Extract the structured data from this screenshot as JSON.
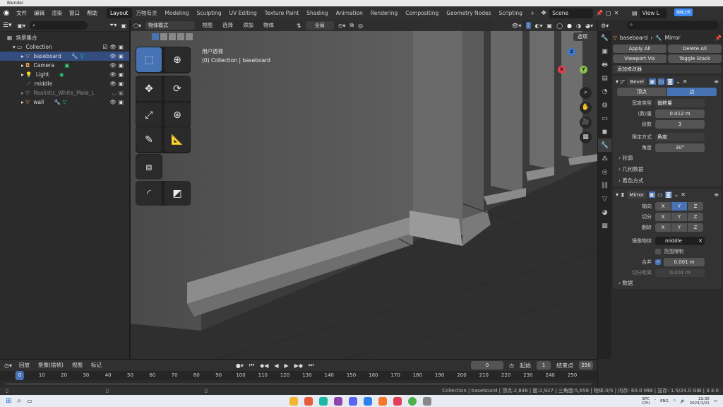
{
  "window": {
    "title": "Blender"
  },
  "menu": [
    "文件",
    "编辑",
    "渲染",
    "窗口",
    "帮助"
  ],
  "workspaces": [
    "Layout",
    "万物有灵",
    "Modeling",
    "Sculpting",
    "UV Editing",
    "Texture Paint",
    "Shading",
    "Animation",
    "Rendering",
    "Compositing",
    "Geometry Nodes",
    "Scripting"
  ],
  "scene": {
    "name": "Scene",
    "view_layer": "View L",
    "upload_badge": "拖拽上传"
  },
  "outliner": {
    "root": "场景集合",
    "collection": "Collection",
    "items": [
      "baseboard",
      "Camera",
      "Light",
      "middle",
      "Realistic_White_Male_L",
      "wall"
    ]
  },
  "viewport": {
    "mode": "物体模式",
    "menus": [
      "视图",
      "选择",
      "添加",
      "物体"
    ],
    "transform": "全局",
    "view_name": "用户透视",
    "view_sub": "(0) Collection | baseboard",
    "options_label": "选项",
    "axes": {
      "x": "X",
      "y": "Y",
      "z": "Z"
    }
  },
  "properties": {
    "object_name": "baseboard",
    "modifier_label": "Mirror",
    "apply_all": "Apply All",
    "delete_all": "Delete All",
    "viewport_vis": "Viewport Vis",
    "toggle_stack": "Toggle Stack",
    "add_modifier": "添加修改器",
    "bevel": {
      "name": "Bevel",
      "tab_vertex": "顶点",
      "tab_edge": "边",
      "width_type_label": "宽度类型",
      "width_type": "偏移量",
      "amount_label": "(数)量",
      "amount": "0.012 m",
      "segments_label": "段数",
      "segments": "3",
      "limit_label": "限定方式",
      "limit": "角度",
      "angle_label": "角度",
      "angle": "30°",
      "sub_profile": "轮廓",
      "sub_geometry": "几何数据",
      "sub_shading": "着色方式"
    },
    "mirror": {
      "name": "Mirror",
      "axis_label": "轴向",
      "bisect_label": "切分",
      "flip_label": "翻转",
      "x": "X",
      "y": "Y",
      "z": "Z",
      "mirror_object_label": "镜像物体",
      "mirror_object": "middle",
      "clipping_label": "范围限制",
      "merge_label": "合并",
      "merge": "0.001 m",
      "bisect_dist_label": "切分距离",
      "bisect_dist": "0.001 m",
      "sub_data": "数据"
    }
  },
  "timeline": {
    "playback": "回放",
    "keying": "抠像(插帧)",
    "view": "视图",
    "marker": "标记",
    "current_frame": "0",
    "start_label": "起始",
    "start": "1",
    "end_label": "结束点",
    "end": "250",
    "ticks": [
      "0",
      "10",
      "20",
      "30",
      "40",
      "50",
      "60",
      "70",
      "80",
      "90",
      "100",
      "110",
      "120",
      "130",
      "140",
      "150",
      "160",
      "170",
      "180",
      "190",
      "200",
      "210",
      "220",
      "230",
      "240",
      "250"
    ]
  },
  "status": {
    "text": "Collection | baseboard | 顶点:2,846 | 面:2,927 | 三角面:5,658 | 物体:0/5 | 内存: 60.0 MiB | 显存: 1.5/24.0 GiB | 3.4.0"
  },
  "taskbar": {
    "time": "22:30",
    "date": "2023/1/21",
    "lang": "ENG",
    "spc": "SPC",
    "cpu": "CPU"
  },
  "colors": {
    "accent": "#4772b3",
    "bg": "#303030"
  }
}
